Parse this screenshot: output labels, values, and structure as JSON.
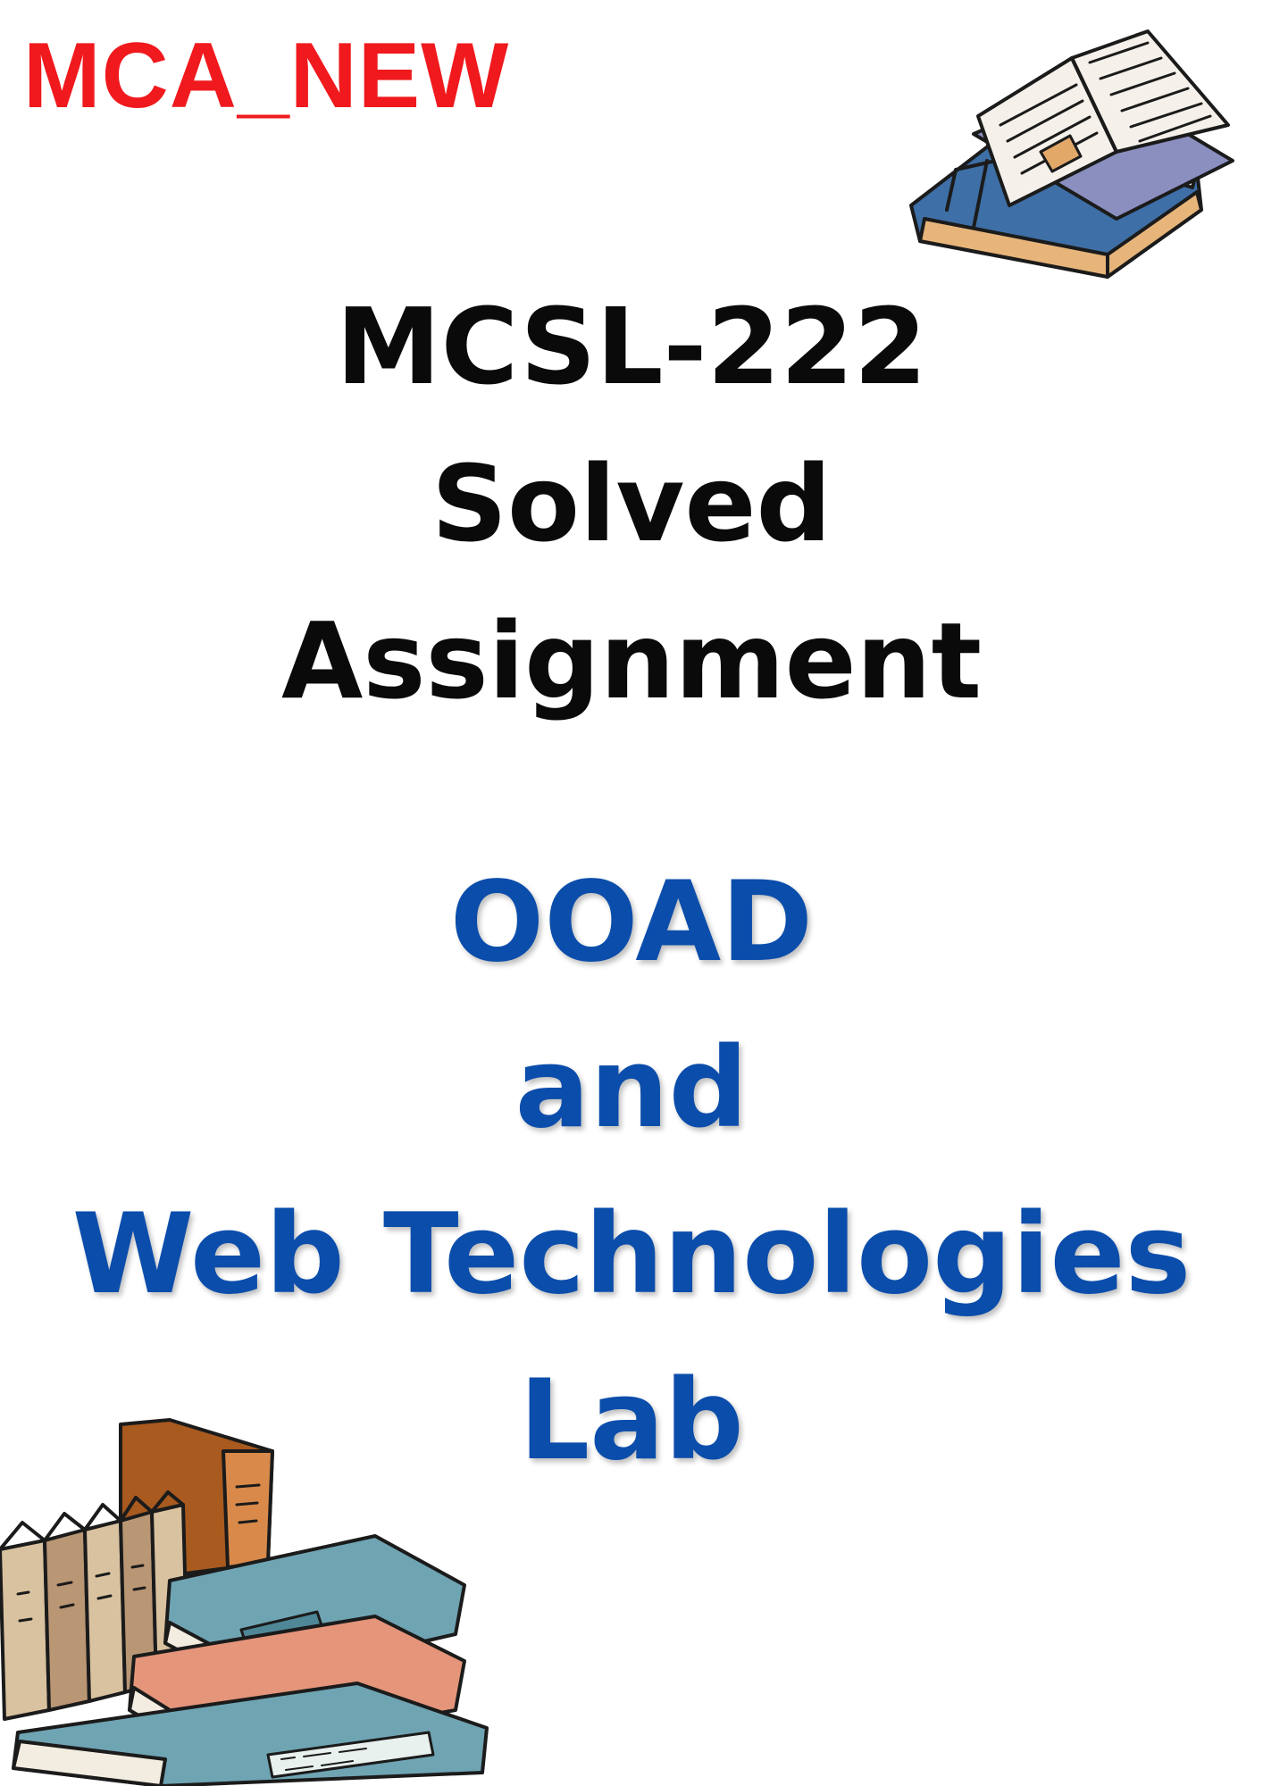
{
  "header": {
    "program_tag": "MCA_NEW"
  },
  "course": {
    "code": "MCSL-222",
    "line2": "Solved",
    "line3": "Assignment"
  },
  "subject": {
    "line1": "OOAD",
    "line2": "and",
    "line3": "Web Technologies",
    "line4": "Lab"
  },
  "colors": {
    "tag": "#f0191d",
    "course_text": "#0a0a0a",
    "subject_text": "#0b4dab"
  },
  "illustrations": {
    "top_right": "open-book-on-closed-book-icon",
    "bottom_left": "stack-of-books-icon"
  }
}
